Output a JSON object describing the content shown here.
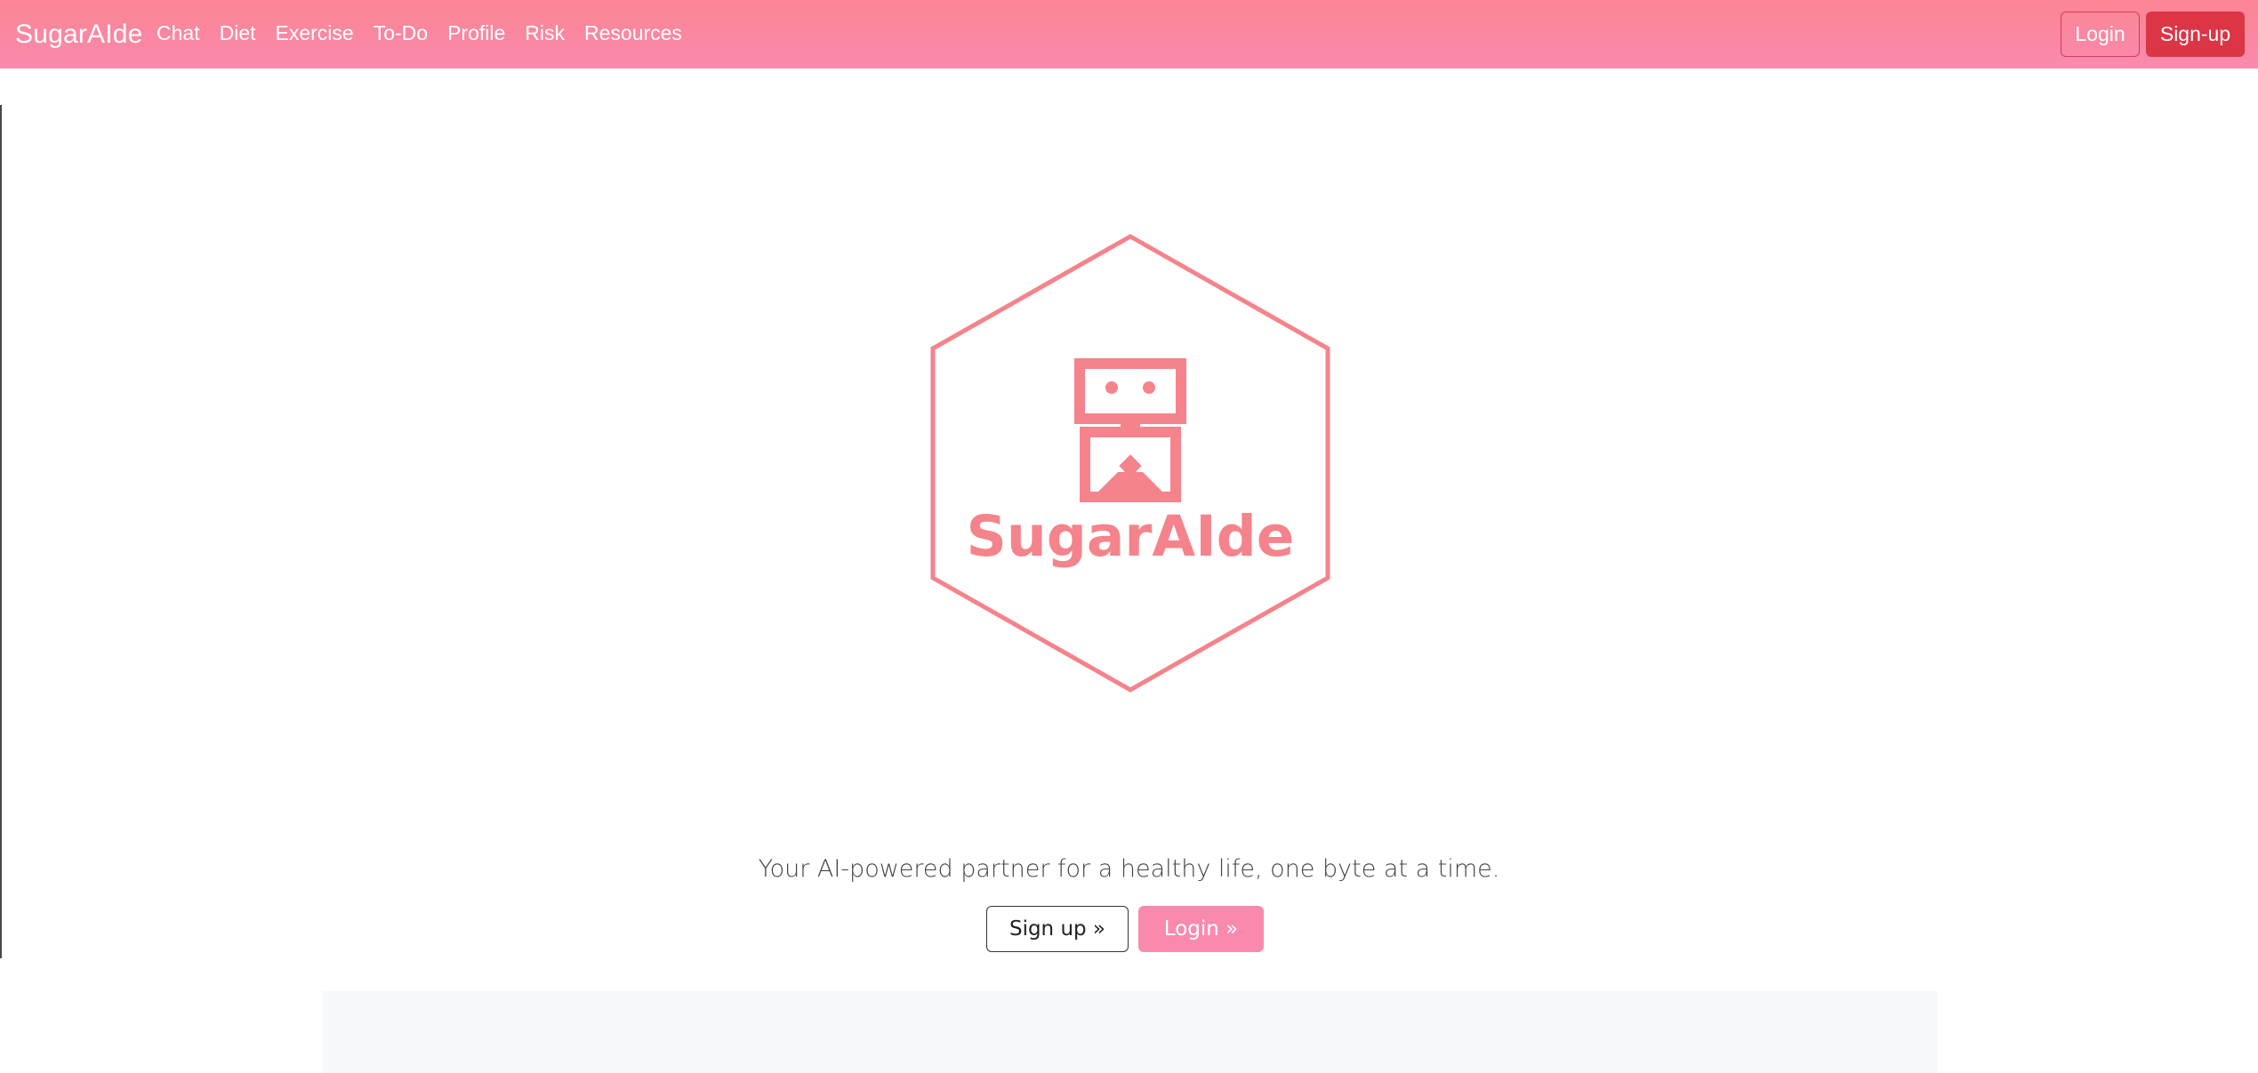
{
  "navbar": {
    "brand": "SugarAIde",
    "links": [
      "Chat",
      "Diet",
      "Exercise",
      "To-Do",
      "Profile",
      "Risk",
      "Resources"
    ],
    "login_label": "Login",
    "signup_label": "Sign-up"
  },
  "hero": {
    "logo_text": "SugarAIde",
    "tagline": "Your AI-powered partner for a healthy life, one byte at a time.",
    "signup_cta": "Sign up »",
    "login_cta": "Login »"
  },
  "colors": {
    "navbar_gradient_top": "#fb8592",
    "navbar_gradient_bottom": "#f98aae",
    "brand_logo": "#f5838b",
    "signup_red": "#dc3545",
    "login_pink": "#f98aae"
  },
  "icons": {
    "logo": "robot-hexagon-icon"
  }
}
